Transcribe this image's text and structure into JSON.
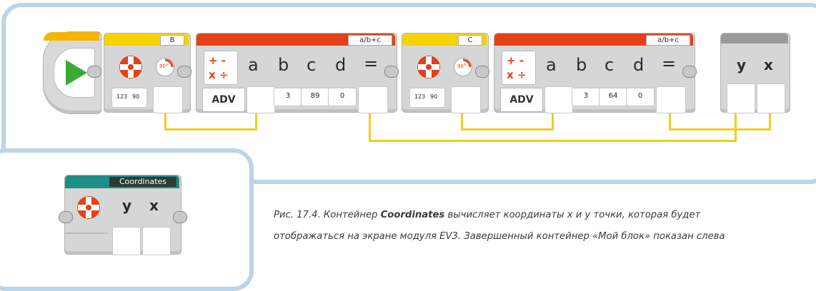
{
  "sequence": {
    "motor_block_1": {
      "port_label": "B",
      "angle_label": "90°",
      "ruler_label": "123",
      "ruler_angle": "90"
    },
    "math_block_1": {
      "mode_label": "a/b+c",
      "operators_plus_minus": "+ -",
      "operators_times_div": "x ÷",
      "mode_button": "ADV",
      "inputs": [
        "a",
        "b",
        "c",
        "d"
      ],
      "equals": "=",
      "values": [
        "3",
        "89",
        "0"
      ]
    },
    "motor_block_2": {
      "port_label": "C",
      "angle_label": "90°",
      "ruler_label": "123",
      "ruler_angle": "90"
    },
    "math_block_2": {
      "mode_label": "a/b+c",
      "operators_plus_minus": "+ -",
      "operators_times_div": "x ÷",
      "mode_button": "ADV",
      "inputs": [
        "a",
        "b",
        "c",
        "d"
      ],
      "equals": "=",
      "values": [
        "3",
        "64",
        "0"
      ]
    },
    "output_block": {
      "outputs": [
        "y",
        "x"
      ]
    }
  },
  "my_block": {
    "title": "Coordinates",
    "outputs": [
      "y",
      "x"
    ]
  },
  "caption": {
    "line1_prefix": "Рис. 17.4. Контейнер ",
    "line1_bold": "Coordinates",
    "line1_suffix": " вычисляет координаты x и y точки, которая будет",
    "line2": "отображаться на экране модуля EV3. Завершенный контейнер «Мой блок» показан слева"
  },
  "colors": {
    "frame": "#bcd4e8",
    "wire": "#f2cd1c",
    "start_play": "#3aaa35",
    "motor_header": "#f5d300",
    "math_header": "#e2411a",
    "my_block_header": "#1d8f86"
  }
}
